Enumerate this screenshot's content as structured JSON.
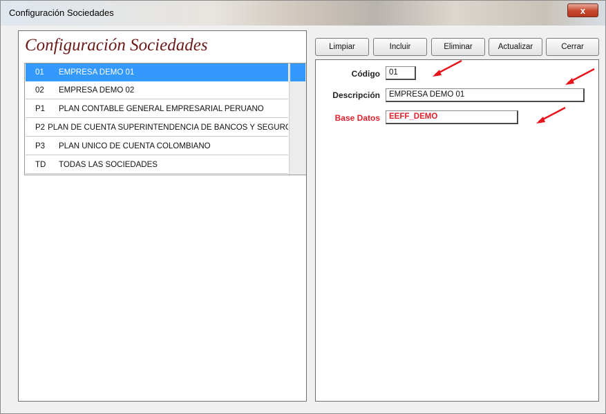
{
  "window": {
    "title": "Configuración Sociedades",
    "close_label": "x"
  },
  "heading": "Configuración Sociedades",
  "toolbar": {
    "limpiar": "Limpiar",
    "incluir": "Incluir",
    "eliminar": "Eliminar",
    "actualizar": "Actualizar",
    "cerrar": "Cerrar"
  },
  "list": {
    "selected_index": 0,
    "items": [
      {
        "code": "01",
        "desc": "EMPRESA DEMO 01"
      },
      {
        "code": "02",
        "desc": "EMPRESA DEMO 02"
      },
      {
        "code": "P1",
        "desc": "PLAN CONTABLE GENERAL EMPRESARIAL PERUANO"
      },
      {
        "code": "P2",
        "desc": "PLAN DE CUENTA SUPERINTENDENCIA DE BANCOS Y SEGURO"
      },
      {
        "code": "P3",
        "desc": "PLAN UNICO DE CUENTA COLOMBIANO"
      },
      {
        "code": "TD",
        "desc": "TODAS LAS SOCIEDADES"
      }
    ]
  },
  "form": {
    "codigo_label": "Código",
    "codigo_value": "01",
    "descripcion_label": "Descripción",
    "descripcion_value": "EMPRESA DEMO 01",
    "base_datos_label": "Base Datos",
    "base_datos_value": "EEFF_DEMO"
  },
  "colors": {
    "selection": "#3399ff",
    "heading": "#6b1a1a",
    "highlight_red": "#e0202a",
    "annotation_arrow": "#e8141c"
  },
  "icons": [
    "close-icon",
    "annotation-arrow-icon"
  ]
}
